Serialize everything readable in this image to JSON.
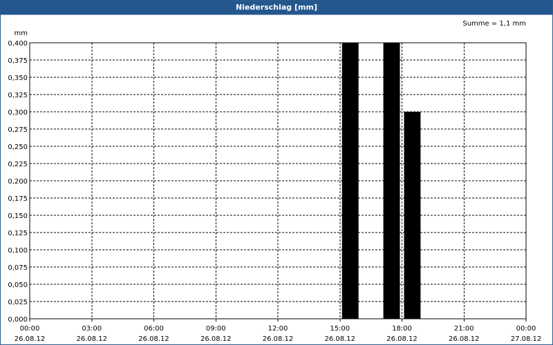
{
  "window": {
    "title": "Niederschlag [mm]"
  },
  "chart_data": {
    "type": "bar",
    "title": "Niederschlag [mm]",
    "ylabel": "mm",
    "annotation": "Summe = 1,1 mm",
    "ylim": [
      0,
      0.4
    ],
    "yticks": [
      "0,000",
      "0,025",
      "0,050",
      "0,075",
      "0,100",
      "0,125",
      "0,150",
      "0,175",
      "0,200",
      "0,225",
      "0,250",
      "0,275",
      "0,300",
      "0,325",
      "0,350",
      "0,375",
      "0,400"
    ],
    "xticks": [
      {
        "time": "00:00",
        "date": "26.08.12"
      },
      {
        "time": "03:00",
        "date": "26.08.12"
      },
      {
        "time": "06:00",
        "date": "26.08.12"
      },
      {
        "time": "09:00",
        "date": "26.08.12"
      },
      {
        "time": "12:00",
        "date": "26.08.12"
      },
      {
        "time": "15:00",
        "date": "26.08.12"
      },
      {
        "time": "18:00",
        "date": "26.08.12"
      },
      {
        "time": "21:00",
        "date": "26.08.12"
      },
      {
        "time": "00:00",
        "date": "27.08.12"
      }
    ],
    "xlim_hours": [
      0,
      24
    ],
    "bars": [
      {
        "start": "26.08.12 15:00",
        "end": "26.08.12 16:00",
        "value": 0.4
      },
      {
        "start": "26.08.12 17:00",
        "end": "26.08.12 18:00",
        "value": 0.4
      },
      {
        "start": "26.08.12 18:00",
        "end": "26.08.12 19:00",
        "value": 0.3
      }
    ],
    "grid": true,
    "colors": {
      "bar": "#000000",
      "grid": "#000000"
    }
  }
}
